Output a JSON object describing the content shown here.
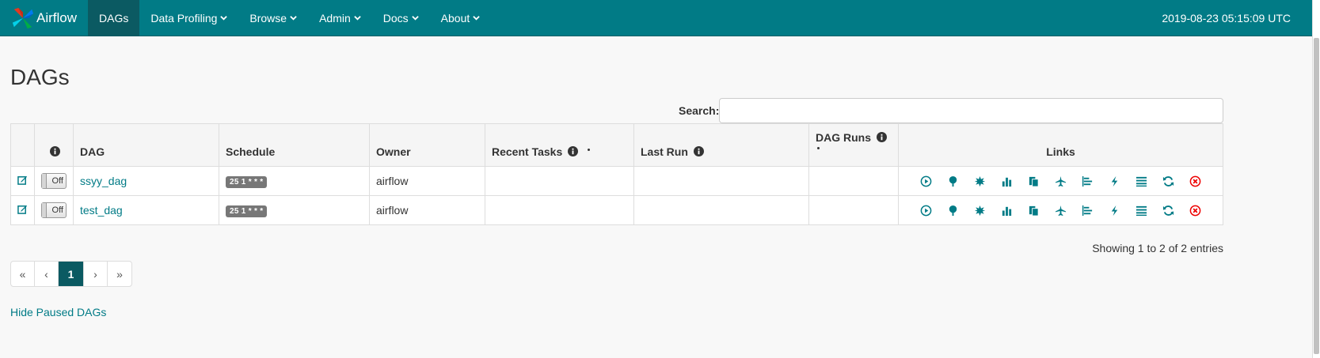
{
  "navbar": {
    "brand": "Airflow",
    "items": [
      {
        "label": "DAGs",
        "active": true
      },
      {
        "label": "Data Profiling",
        "dropdown": true
      },
      {
        "label": "Browse",
        "dropdown": true
      },
      {
        "label": "Admin",
        "dropdown": true
      },
      {
        "label": "Docs",
        "dropdown": true
      },
      {
        "label": "About",
        "dropdown": true
      }
    ],
    "clock": "2019-08-23 05:15:09 UTC",
    "bg_color": "#017b86"
  },
  "page": {
    "title": "DAGs",
    "search_label": "Search:",
    "search_value": ""
  },
  "table": {
    "headers": {
      "dag": "DAG",
      "schedule": "Schedule",
      "owner": "Owner",
      "recent_tasks": "Recent Tasks",
      "last_run": "Last Run",
      "dag_runs": "DAG Runs",
      "links": "Links"
    },
    "rows": [
      {
        "dag": "ssyy_dag",
        "toggle": "Off",
        "schedule": "25 1 * * *",
        "owner": "airflow",
        "recent_tasks": "",
        "last_run": "",
        "dag_runs": ""
      },
      {
        "dag": "test_dag",
        "toggle": "Off",
        "schedule": "25 1 * * *",
        "owner": "airflow",
        "recent_tasks": "",
        "last_run": "",
        "dag_runs": ""
      }
    ],
    "link_icons": [
      "trigger-dag-icon",
      "tree-view-icon",
      "graph-view-icon",
      "tries-chart-icon",
      "code-view-icon",
      "landing-times-icon",
      "gantt-icon",
      "logs-icon",
      "duration-icon",
      "refresh-icon",
      "delete-dag-icon"
    ]
  },
  "entries_text": "Showing 1 to 2 of 2 entries",
  "pagination": {
    "first": "«",
    "prev": "‹",
    "current": "1",
    "next": "›",
    "last": "»"
  },
  "hide_paused": "Hide Paused DAGs"
}
